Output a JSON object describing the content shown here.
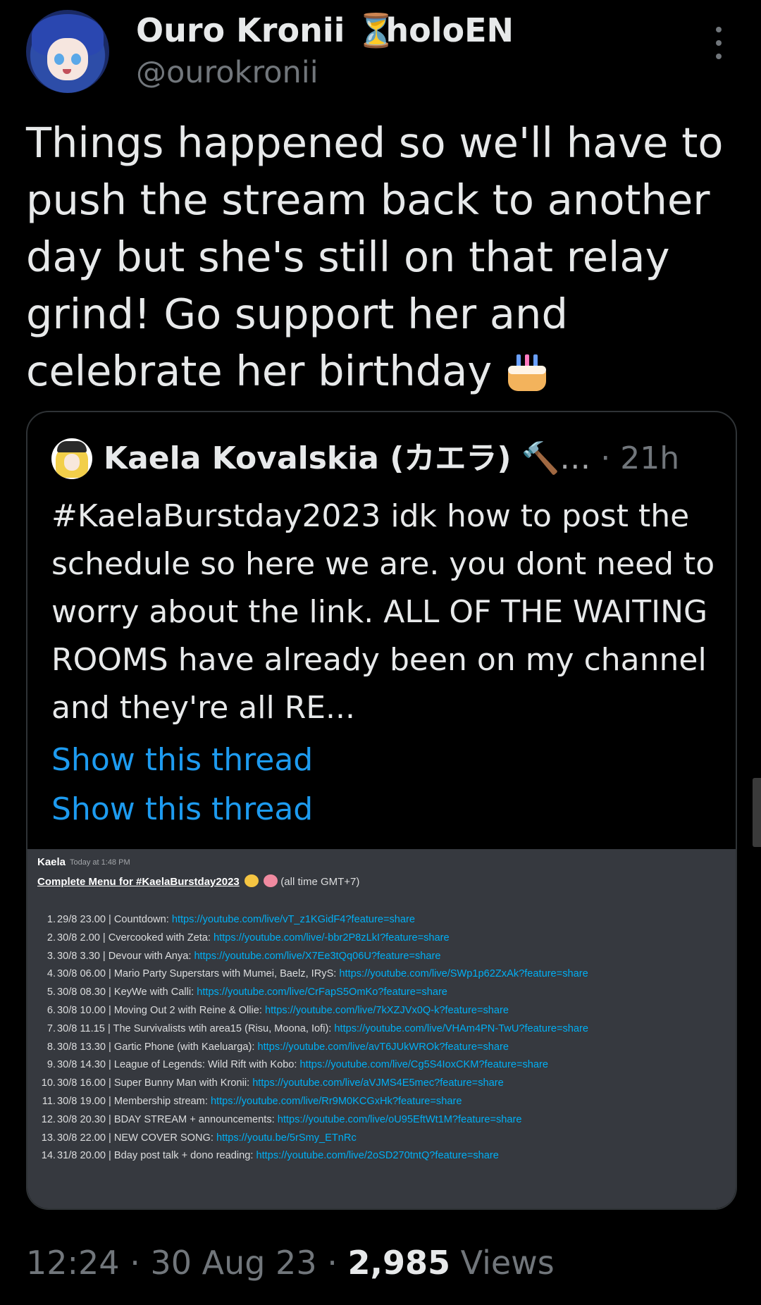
{
  "author": {
    "display_name": "Ouro Kronii",
    "badge_glyph": "⏳",
    "affiliation": "holoEN",
    "handle": "@ourokronii",
    "avatar_icon": "avatar-icon"
  },
  "more_icon": "more-vertical-icon",
  "tweet": {
    "text": "Things happened so we'll have to push the stream back to another day but she's still on that relay grind! Go support her and celebrate her birthday",
    "emoji": "cake-icon"
  },
  "quoted_tweet": {
    "author_name": "Kaela Kovalskia (カエラ)",
    "author_suffix": "🔨…",
    "separator": "·",
    "time": "21h",
    "text": "#KaelaBurstday2023 idk how to post the schedule so here we are. you dont need to worry about the link. ALL OF THE WAITING ROOMS have already been on my channel and they're all RE...",
    "show_thread_1": "Show this thread",
    "show_thread_2": "Show this thread",
    "attachment": {
      "author": "Kaela",
      "timestamp": "Today at 1:48 PM",
      "title": "Complete Menu for #KaelaBurstday2023",
      "title_suffix": "(all time GMT+7)",
      "items": [
        {
          "num": "1.",
          "text": "29/8 23.00 | Countdown: ",
          "link": "https://youtube.com/live/vT_z1KGidF4?feature=share"
        },
        {
          "num": "2.",
          "text": "30/8 2.00 | Cvercooked with Zeta: ",
          "link": "https://youtube.com/live/-bbr2P8zLkI?feature=share"
        },
        {
          "num": "3.",
          "text": "30/8 3.30 | Devour with Anya: ",
          "link": "https://youtube.com/live/X7Ee3tQq06U?feature=share"
        },
        {
          "num": "4.",
          "text": "30/8 06.00 | Mario Party Superstars with Mumei, Baelz, IRyS: ",
          "link": "https://youtube.com/live/SWp1p62ZxAk?feature=share"
        },
        {
          "num": "5.",
          "text": "30/8 08.30 | KeyWe with Calli: ",
          "link": "https://youtube.com/live/CrFapS5OmKo?feature=share"
        },
        {
          "num": "6.",
          "text": "30/8 10.00 | Moving Out 2 with Reine & Ollie: ",
          "link": "https://youtube.com/live/7kXZJVx0Q-k?feature=share"
        },
        {
          "num": "7.",
          "text": "30/8 11.15 | The Survivalists wtih area15 (Risu, Moona, Iofi): ",
          "link": "https://youtube.com/live/VHAm4PN-TwU?feature=share"
        },
        {
          "num": "8.",
          "text": "30/8 13.30 | Gartic Phone (with Kaeluarga): ",
          "link": "https://youtube.com/live/avT6JUkWROk?feature=share"
        },
        {
          "num": "9.",
          "text": "30/8 14.30 | League of Legends: Wild Rift with Kobo: ",
          "link": "https://youtube.com/live/Cg5S4IoxCKM?feature=share"
        },
        {
          "num": "10.",
          "text": "30/8 16.00 | Super Bunny Man with Kronii: ",
          "link": "https://youtube.com/live/aVJMS4E5mec?feature=share"
        },
        {
          "num": "11.",
          "text": "30/8 19.00 | Membership stream: ",
          "link": "https://youtube.com/live/Rr9M0KCGxHk?feature=share"
        },
        {
          "num": "12.",
          "text": "30/8 20.30 | BDAY STREAM + announcements: ",
          "link": "https://youtube.com/live/oU95EftWt1M?feature=share"
        },
        {
          "num": "13.",
          "text": "30/8 22.00 | NEW COVER SONG: ",
          "link": "https://youtu.be/5rSmy_ETnRc"
        },
        {
          "num": "14.",
          "text": "31/8 20.00 | Bday post talk + dono reading: ",
          "link": "https://youtube.com/live/2oSD270tntQ?feature=share"
        }
      ]
    }
  },
  "footer": {
    "time": "12:24",
    "separator": "·",
    "date": "30 Aug 23",
    "views_count": "2,985",
    "views_label": "Views"
  },
  "colors": {
    "background": "#000000",
    "text": "#e7e9ea",
    "muted": "#71767b",
    "link": "#1d9bf0",
    "discord_bg": "#36393f",
    "discord_link": "#00aff4"
  }
}
